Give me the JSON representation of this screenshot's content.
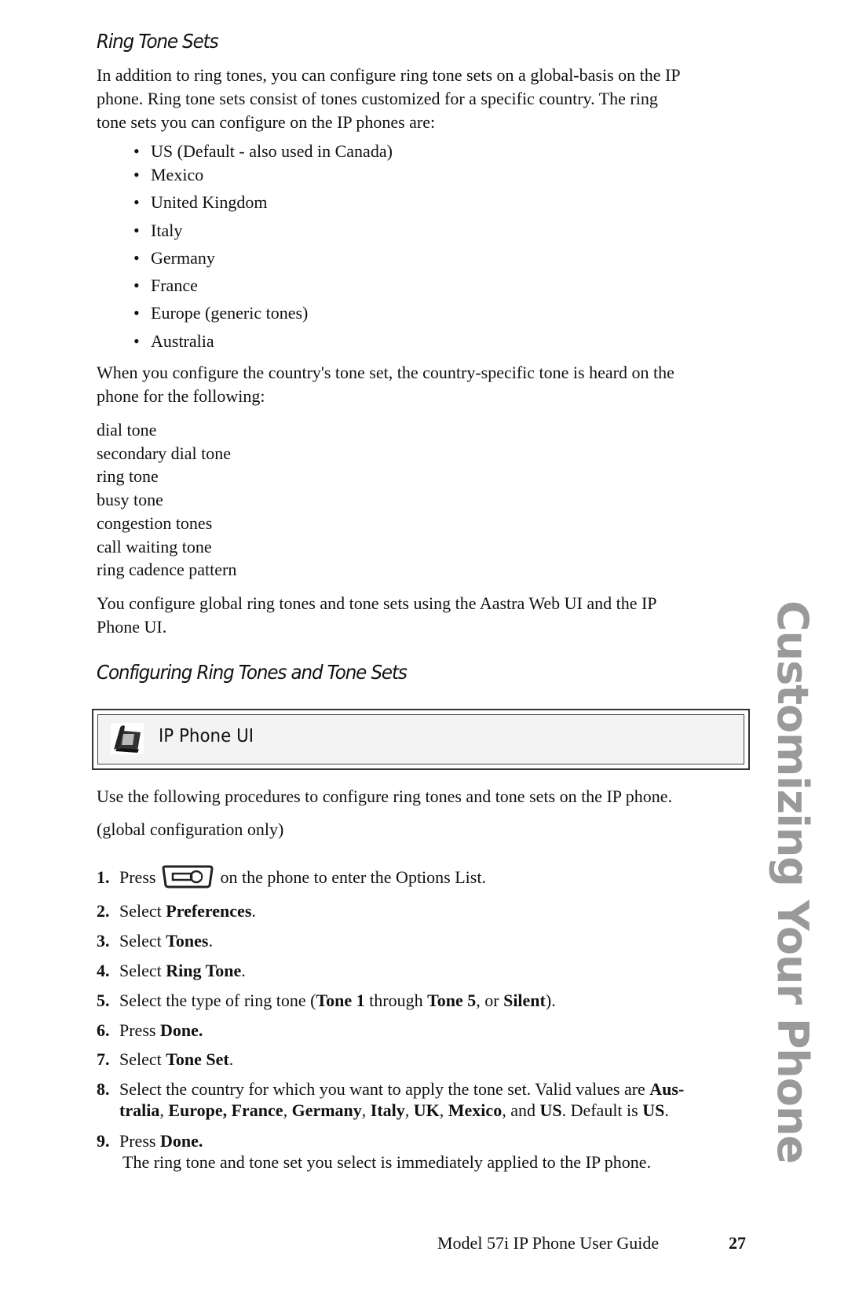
{
  "section1": {
    "heading": "Ring Tone Sets",
    "intro_lines": [
      "In addition to ring tones, you can configure ring tone sets on a global-basis on the IP",
      "phone. Ring tone sets consist of tones customized for a specific country. The ring",
      "tone sets you can configure on the IP phones are:"
    ],
    "countries": [
      "US (Default - also used in Canada)",
      "Mexico",
      "United Kingdom",
      "Italy",
      "Germany",
      "France",
      "Europe (generic tones)",
      "Australia"
    ],
    "tone_intro_lines": [
      "When you configure the country's tone set, the country-specific tone is heard on the",
      "phone for the following:"
    ],
    "tones": [
      "dial tone",
      "secondary dial tone",
      "ring tone",
      "busy tone",
      "congestion tones",
      "call waiting tone",
      "ring cadence pattern"
    ],
    "config_note_lines": [
      "You configure global ring tones and tone sets using the Aastra Web UI and the IP",
      "Phone UI."
    ]
  },
  "section2": {
    "heading": "Configuring Ring Tones and Tone Sets",
    "ui_box": {
      "icon": "desk-phone-icon",
      "label": "IP Phone UI"
    },
    "procedure_intro": "Use the following procedures to configure ring tones and tone sets on the IP phone.",
    "scope_note": "(global configuration only)",
    "steps": [
      {
        "num": "1.",
        "pre": "Press",
        "icon": "options-key-icon",
        "post": "on the phone to enter the Options List."
      },
      {
        "num": "2.",
        "pre": "Select ",
        "bold": "Preferences",
        "post": "."
      },
      {
        "num": "3.",
        "pre": "Select ",
        "bold": "Tones",
        "post": "."
      },
      {
        "num": "4.",
        "pre": "Select ",
        "bold": "Ring Tone",
        "post": "."
      },
      {
        "num": "5.",
        "parts": [
          "Select the type of ring tone (",
          "Tone 1",
          " through ",
          "Tone 5",
          ", or ",
          "Silent",
          ")."
        ]
      },
      {
        "num": "6.",
        "pre": "Press ",
        "bold": "Done."
      },
      {
        "num": "7.",
        "pre": "Select ",
        "bold": "Tone Set",
        "post": "."
      },
      {
        "num": "8.",
        "line1_pre": "Select the country for which you want to apply the tone set. Valid values are ",
        "line1_bold": "Aus-",
        "line2_parts": [
          "tralia",
          ", ",
          "Europe, France",
          ", ",
          "Germany",
          ", ",
          "Italy",
          ", ",
          "UK",
          ", ",
          "Mexico",
          ", and ",
          "US",
          ". Default is ",
          "US",
          "."
        ]
      },
      {
        "num": "9.",
        "pre": "Press ",
        "bold": "Done.",
        "detail": "The ring tone and tone set you select is immediately applied to the IP phone."
      }
    ]
  },
  "side_tab": "Customizing Your Phone",
  "footer": {
    "title": "Model 57i IP Phone User Guide",
    "page_number": "27"
  }
}
